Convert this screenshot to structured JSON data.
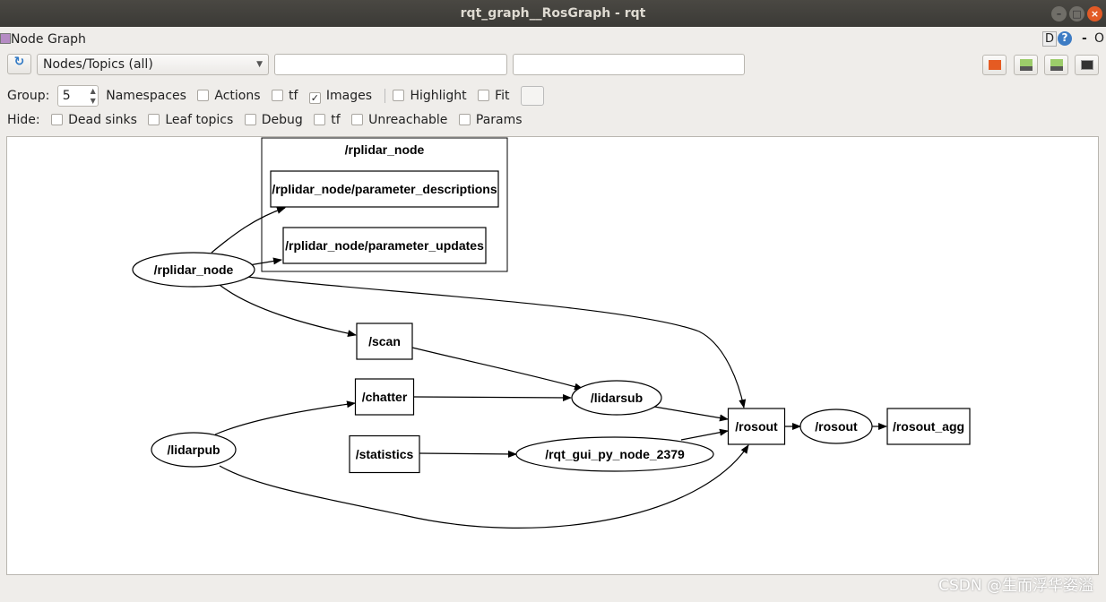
{
  "window": {
    "title": "rqt_graph__RosGraph - rqt",
    "min": "–",
    "max": "□",
    "close": "×"
  },
  "plugin": {
    "title": "Node Graph",
    "d_label": "D",
    "help": "?",
    "dash": "-",
    "o": "O"
  },
  "toolbar": {
    "refresh_icon": "refresh-icon",
    "mode": "Nodes/Topics (all)",
    "filter1": "",
    "filter2": ""
  },
  "row2": {
    "group_label": "Group:",
    "group_value": "5",
    "namespaces": "Namespaces",
    "actions": "Actions",
    "tf": "tf",
    "images": "Images",
    "highlight": "Highlight",
    "fit": "Fit",
    "images_checked": true
  },
  "row3": {
    "hide_label": "Hide:",
    "dead_sinks": "Dead sinks",
    "leaf_topics": "Leaf topics",
    "debug": "Debug",
    "tf": "tf",
    "unreachable": "Unreachable",
    "params": "Params"
  },
  "graph": {
    "cluster": "/rplidar_node",
    "nodes": [
      {
        "id": "pd",
        "label": "/rplidar_node/parameter_descriptions",
        "shape": "box"
      },
      {
        "id": "pu",
        "label": "/rplidar_node/parameter_updates",
        "shape": "box"
      },
      {
        "id": "rn",
        "label": "/rplidar_node",
        "shape": "ellipse"
      },
      {
        "id": "scan",
        "label": "/scan",
        "shape": "box"
      },
      {
        "id": "chatter",
        "label": "/chatter",
        "shape": "box"
      },
      {
        "id": "lidarsub",
        "label": "/lidarsub",
        "shape": "ellipse"
      },
      {
        "id": "lidarpub",
        "label": "/lidarpub",
        "shape": "ellipse"
      },
      {
        "id": "statistics",
        "label": "/statistics",
        "shape": "box"
      },
      {
        "id": "rqt",
        "label": "/rqt_gui_py_node_2379",
        "shape": "ellipse"
      },
      {
        "id": "rosout_t",
        "label": "/rosout",
        "shape": "box"
      },
      {
        "id": "rosout_n",
        "label": "/rosout",
        "shape": "ellipse"
      },
      {
        "id": "rosout_agg",
        "label": "/rosout_agg",
        "shape": "box"
      }
    ],
    "edges": [
      {
        "from": "rn",
        "to": "pd"
      },
      {
        "from": "rn",
        "to": "pu"
      },
      {
        "from": "rn",
        "to": "rosout_t"
      },
      {
        "from": "rn",
        "to": "scan"
      },
      {
        "from": "scan",
        "to": "lidarsub"
      },
      {
        "from": "chatter",
        "to": "lidarsub"
      },
      {
        "from": "lidarsub",
        "to": "rosout_t"
      },
      {
        "from": "lidarpub",
        "to": "chatter"
      },
      {
        "from": "statistics",
        "to": "rqt"
      },
      {
        "from": "rqt",
        "to": "rosout_t"
      },
      {
        "from": "lidarpub",
        "to": "rosout_t"
      },
      {
        "from": "rosout_t",
        "to": "rosout_n"
      },
      {
        "from": "rosout_n",
        "to": "rosout_agg"
      }
    ]
  },
  "watermark": "CSDN @生而浮华姿溢"
}
